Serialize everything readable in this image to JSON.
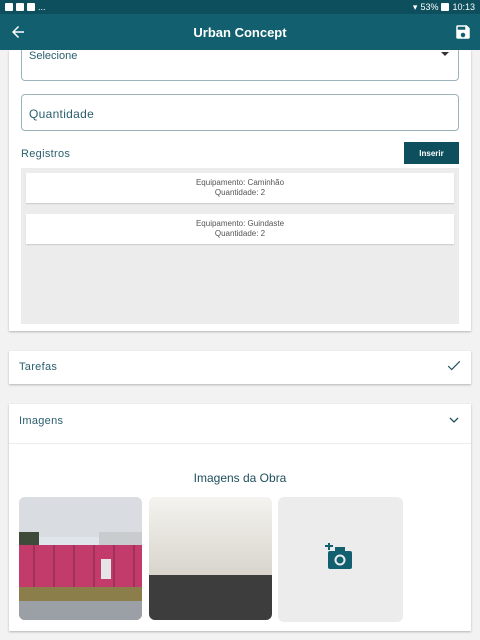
{
  "status_bar": {
    "left_text": "...",
    "battery": "53%",
    "time": "10:13"
  },
  "app_bar": {
    "title": "Urban Concept"
  },
  "form": {
    "select_value": "Selecione",
    "quantity_placeholder": "Quantidade",
    "records_label": "Registros",
    "insert_button": "Inserir",
    "records": [
      {
        "equipment": "Equipamento: Caminhão",
        "quantity": "Quantidade: 2"
      },
      {
        "equipment": "Equipamento: Guindaste",
        "quantity": "Quantidade: 2"
      }
    ]
  },
  "tasks_section": {
    "label": "Tarefas",
    "status_icon": "check-icon"
  },
  "images_section": {
    "label": "Imagens",
    "toggle_icon": "chevron-down-icon",
    "subtitle": "Imagens da Obra",
    "add_icon": "add-photo-icon"
  },
  "colors": {
    "primary": "#12606f",
    "primary_dark": "#0d4f5d",
    "text": "#2b5f6d"
  }
}
